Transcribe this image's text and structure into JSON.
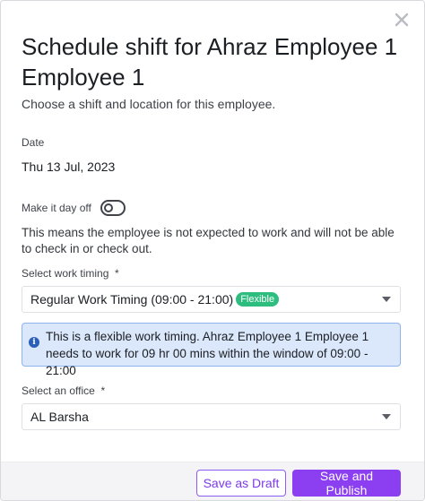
{
  "dialog": {
    "title": "Schedule shift for Ahraz Employee 1 Employee 1",
    "subtitle": "Choose a shift and location for this employee.",
    "close_icon": "close-icon"
  },
  "date": {
    "label": "Date",
    "value": "Thu 13 Jul, 2023"
  },
  "day_off": {
    "label": "Make it day off",
    "enabled": false,
    "note": "This means the employee is not expected to work and will not be able to check in or check out."
  },
  "work_timing": {
    "label": "Select work timing",
    "required_mark": "*",
    "selected": "Regular Work Timing (09:00 - 21:00)",
    "badge": "Flexible",
    "badge_color": "#2dbd7e"
  },
  "info_banner": {
    "icon": "info-icon",
    "text": "This is a flexible work timing. Ahraz Employee 1 Employee 1 needs to work for 09 hr 00 mins within the window of 09:00 - 21:00"
  },
  "office": {
    "label": "Select an office",
    "required_mark": "*",
    "selected": "AL Barsha"
  },
  "footer": {
    "save_draft_label": "Save as Draft",
    "save_publish_label": "Save and Publish",
    "accent_color": "#8b3ff0"
  }
}
